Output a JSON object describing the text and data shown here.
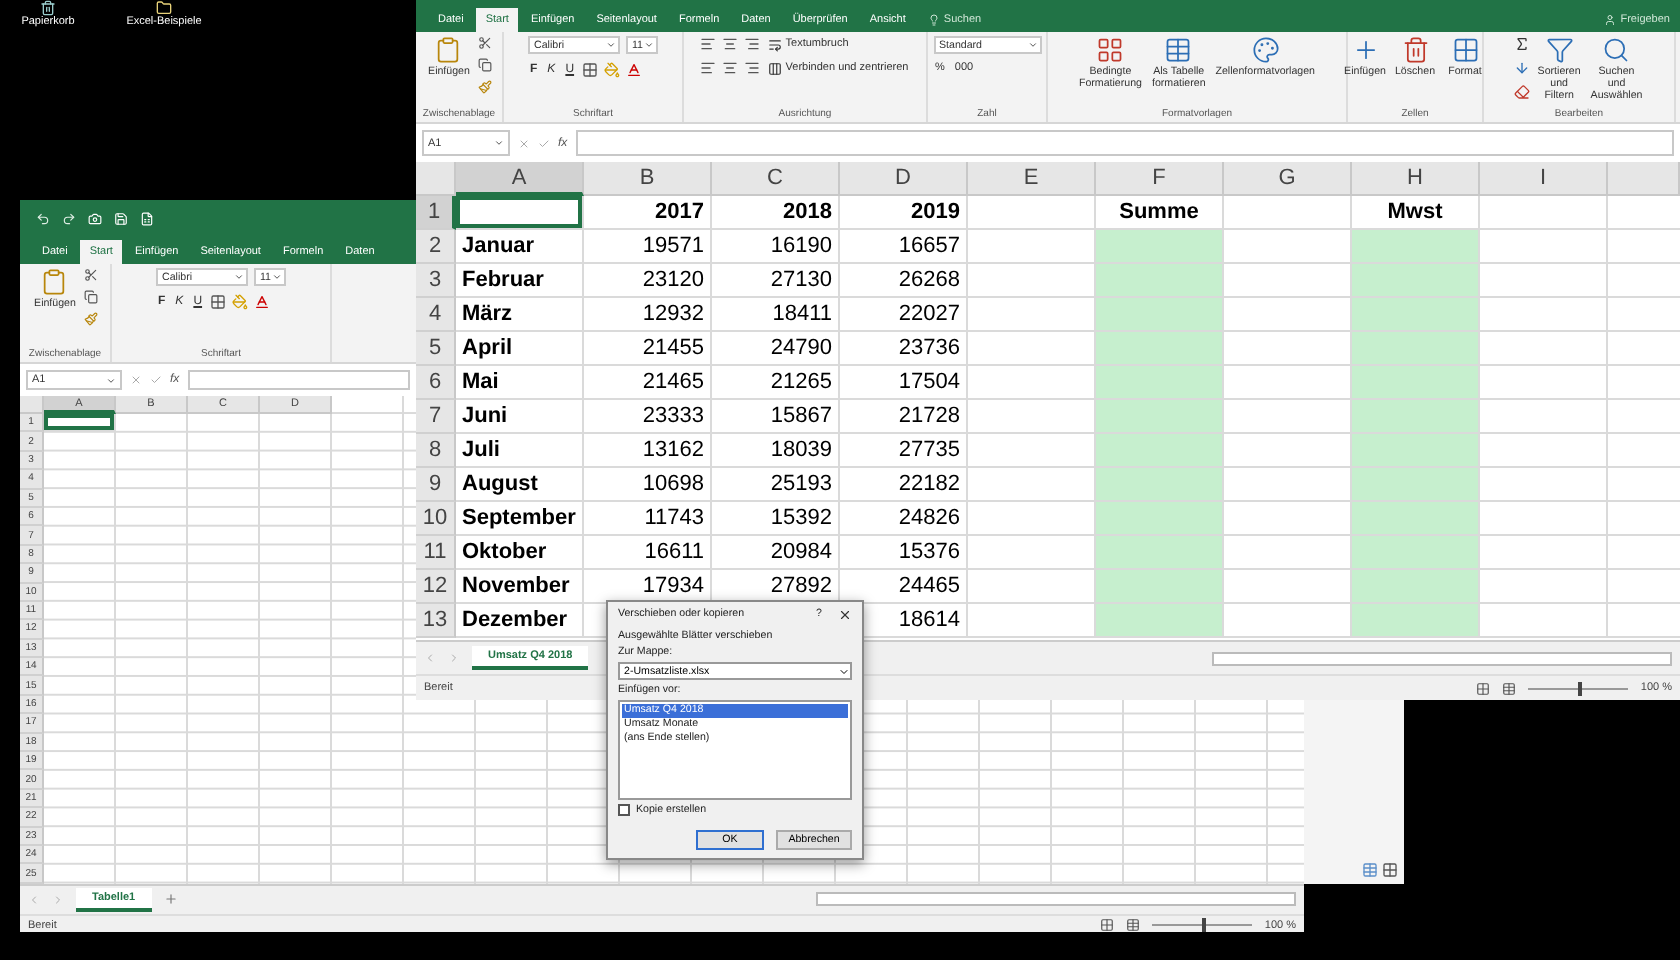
{
  "desktop_icons": [
    {
      "label": "Papierkorb",
      "kind": "bin"
    },
    {
      "label": "Excel-Beispiele",
      "kind": "folder"
    }
  ],
  "back_window": {
    "tabs": [
      {
        "label": "Datei",
        "selected": false
      },
      {
        "label": "Start",
        "selected": true
      },
      {
        "label": "Einfügen",
        "selected": false
      },
      {
        "label": "Seitenlayout",
        "selected": false
      },
      {
        "label": "Formeln",
        "selected": false
      },
      {
        "label": "Daten",
        "selected": false
      }
    ],
    "groups": [
      {
        "label": "Zwischenablage",
        "items": [
          {
            "kind": "large",
            "label": "Einfügen"
          }
        ]
      },
      {
        "label": "Schriftart",
        "items": [
          {
            "kind": "font",
            "font": "Calibri",
            "size": "11",
            "styles": [
              "F",
              "K",
              "U"
            ]
          }
        ]
      }
    ],
    "name_box": "A1",
    "formula_label": "fx",
    "columns": [
      {
        "label": "A",
        "selected": true
      },
      {
        "label": "B",
        "selected": false
      },
      {
        "label": "C",
        "selected": false
      },
      {
        "label": "D",
        "selected": false
      }
    ],
    "row_numbers": [
      "1",
      "2",
      "3",
      "4",
      "5",
      "6",
      "7",
      "8",
      "9",
      "10",
      "11",
      "12",
      "13",
      "14",
      "15",
      "16",
      "17",
      "18",
      "19",
      "20",
      "21",
      "22",
      "23",
      "24",
      "25"
    ],
    "sheet_tabs": [
      {
        "label": "Tabelle1",
        "selected": true
      }
    ],
    "status": "Bereit",
    "zoom": {
      "label": "100 %",
      "level": 0.5
    }
  },
  "main_window": {
    "tabs": [
      {
        "label": "Datei",
        "selected": false
      },
      {
        "label": "Start",
        "selected": true
      },
      {
        "label": "Einfügen",
        "selected": false
      },
      {
        "label": "Seitenlayout",
        "selected": false
      },
      {
        "label": "Formeln",
        "selected": false
      },
      {
        "label": "Daten",
        "selected": false
      },
      {
        "label": "Überprüfen",
        "selected": false
      },
      {
        "label": "Ansicht",
        "selected": false
      }
    ],
    "search": "Suchen",
    "share": "Freigeben",
    "groups": [
      {
        "label": "Zwischenablage",
        "items": [
          {
            "kind": "large",
            "label": "Einfügen"
          }
        ]
      },
      {
        "label": "Schriftart",
        "items": [
          {
            "kind": "font",
            "font": "Calibri",
            "size": "11",
            "styles": [
              "F",
              "K",
              "U"
            ]
          }
        ]
      },
      {
        "label": "Ausrichtung",
        "items": [
          {
            "kind": "align",
            "wrap": "Textumbruch",
            "merge": "Verbinden und zentrieren"
          }
        ]
      },
      {
        "label": "Zahl",
        "items": [
          {
            "kind": "number",
            "format": "Standard",
            "percent": "%",
            "thousands": "000"
          }
        ]
      },
      {
        "label": "Formatvorlagen",
        "items": [
          {
            "kind": "large",
            "label": "Bedingte Formatierung"
          },
          {
            "kind": "large",
            "label": "Als Tabelle formatieren"
          },
          {
            "kind": "large",
            "label": "Zellenformatvorlagen"
          }
        ]
      },
      {
        "label": "Zellen",
        "items": [
          {
            "kind": "large",
            "label": "Einfügen"
          },
          {
            "kind": "large",
            "label": "Löschen"
          },
          {
            "kind": "large",
            "label": "Format"
          }
        ]
      },
      {
        "label": "Bearbeiten",
        "items": [
          {
            "kind": "sum"
          },
          {
            "kind": "large",
            "label": "Sortieren und Filtern"
          },
          {
            "kind": "large",
            "label": "Suchen und Auswählen"
          }
        ]
      }
    ],
    "name_box": "A1",
    "formula_label": "fx",
    "columns": [
      {
        "label": "A",
        "selected": true,
        "shaded": false
      },
      {
        "label": "B",
        "selected": false,
        "shaded": false
      },
      {
        "label": "C",
        "selected": false,
        "shaded": false
      },
      {
        "label": "D",
        "selected": false,
        "shaded": false
      },
      {
        "label": "E",
        "selected": false,
        "shaded": false
      },
      {
        "label": "F",
        "selected": false,
        "shaded": true
      },
      {
        "label": "G",
        "selected": false,
        "shaded": false
      },
      {
        "label": "H",
        "selected": false,
        "shaded": true
      },
      {
        "label": "I",
        "selected": false,
        "shaded": false
      }
    ],
    "rows": [
      {
        "number": "1",
        "selected": true,
        "cells": [
          null,
          "2017",
          "2018",
          "2019",
          null,
          "Summe",
          null,
          "Mwst",
          null
        ]
      },
      {
        "number": "2",
        "selected": false,
        "cells": [
          "Januar",
          "19571",
          "16190",
          "16657",
          null,
          null,
          null,
          null,
          null
        ]
      },
      {
        "number": "3",
        "selected": false,
        "cells": [
          "Februar",
          "23120",
          "27130",
          "26268",
          null,
          null,
          null,
          null,
          null
        ]
      },
      {
        "number": "4",
        "selected": false,
        "cells": [
          "März",
          "12932",
          "18411",
          "22027",
          null,
          null,
          null,
          null,
          null
        ]
      },
      {
        "number": "5",
        "selected": false,
        "cells": [
          "April",
          "21455",
          "24790",
          "23736",
          null,
          null,
          null,
          null,
          null
        ]
      },
      {
        "number": "6",
        "selected": false,
        "cells": [
          "Mai",
          "21465",
          "21265",
          "17504",
          null,
          null,
          null,
          null,
          null
        ]
      },
      {
        "number": "7",
        "selected": false,
        "cells": [
          "Juni",
          "23333",
          "15867",
          "21728",
          null,
          null,
          null,
          null,
          null
        ]
      },
      {
        "number": "8",
        "selected": false,
        "cells": [
          "Juli",
          "13162",
          "18039",
          "27735",
          null,
          null,
          null,
          null,
          null
        ]
      },
      {
        "number": "9",
        "selected": false,
        "cells": [
          "August",
          "10698",
          "25193",
          "22182",
          null,
          null,
          null,
          null,
          null
        ]
      },
      {
        "number": "10",
        "selected": false,
        "cells": [
          "September",
          "11743",
          "15392",
          "24826",
          null,
          null,
          null,
          null,
          null
        ]
      },
      {
        "number": "11",
        "selected": false,
        "cells": [
          "Oktober",
          "16611",
          "20984",
          "15376",
          null,
          null,
          null,
          null,
          null
        ]
      },
      {
        "number": "12",
        "selected": false,
        "cells": [
          "November",
          "17934",
          "27892",
          "24465",
          null,
          null,
          null,
          null,
          null
        ]
      },
      {
        "number": "13",
        "selected": false,
        "cells": [
          "Dezember",
          null,
          null,
          "18614",
          null,
          null,
          null,
          null,
          null
        ]
      }
    ],
    "sheet_tabs": [
      {
        "label": "Umsatz Q4 2018",
        "selected": true
      }
    ],
    "status": "Bereit",
    "zoom": {
      "label": "100 %",
      "level": 0.5
    }
  },
  "dialog": {
    "title": "Verschieben oder kopieren",
    "help": "?",
    "heading": "Ausgewählte Blätter verschieben",
    "book_label": "Zur Mappe:",
    "book": "2-Umsatzliste.xlsx",
    "before_label": "Einfügen vor:",
    "sheets": [
      {
        "label": "Umsatz Q4 2018",
        "selected": true
      },
      {
        "label": "Umsatz Monate",
        "selected": false
      },
      {
        "label": "(ans Ende stellen)",
        "selected": false
      }
    ],
    "copy": {
      "label": "Kopie erstellen",
      "checked": false
    },
    "buttons": [
      {
        "label": "OK",
        "kind": "default"
      },
      {
        "label": "Abbrechen",
        "kind": "normal"
      }
    ]
  }
}
